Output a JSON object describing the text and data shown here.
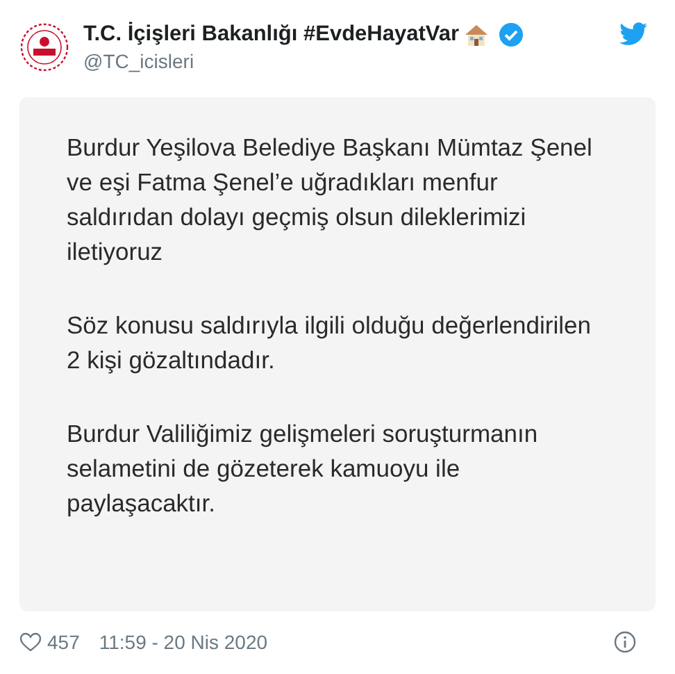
{
  "author": {
    "name": "T.C. İçişleri Bakanlığı #EvdeHayatVar",
    "handle": "@TC_icisleri",
    "verified": true
  },
  "image_text": [
    "Burdur Yeşilova Belediye Başkanı Mümtaz Şenel ve eşi Fatma Şenel’e uğradıkları menfur saldırıdan dolayı geçmiş olsun dileklerimizi iletiyoruz",
    "Söz konusu saldırıyla ilgili olduğu değerlendirilen 2 kişi gözaltındadır.",
    "Burdur Valiliğimiz gelişmeleri soruşturmanın selametini de gözeterek kamuoyu ile paylaşacaktır."
  ],
  "footer": {
    "likes": "457",
    "timestamp": "11:59 - 20 Nis 2020"
  }
}
